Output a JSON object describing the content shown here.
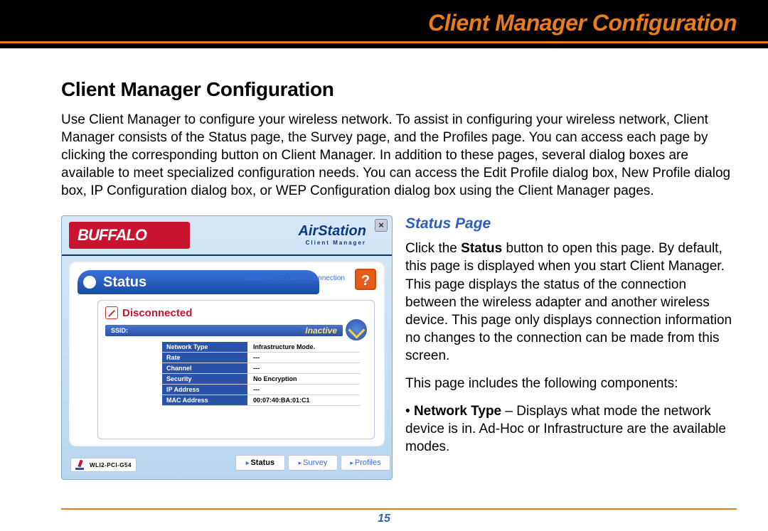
{
  "header": {
    "title": "Client Manager Configuration"
  },
  "doc": {
    "heading": "Client Manager Configuration",
    "intro": "Use Client Manager to configure your wireless network. To assist in configuring your wireless network, Client Manager consists of the Status page, the Survey page, and the Profiles page. You can access each page by clicking the corresponding button on Client Manager. In addition to these pages, several dialog boxes are available to meet specialized configuration needs. You can access the Edit Profile dialog box, New Profile dialog box, IP Configuration dialog box, or WEP Configuration dialog box using the Client Manager pages.",
    "sub_heading": "Status Page",
    "para1_a": "Click the ",
    "para1_b": "Status",
    "para1_c": " button to open this page. By default, this page is displayed when you start Client Manager. This page displays the status of the connection between the wireless adapter and another wireless device. This page only displays connection information no changes to the connection can be made from this screen.",
    "para2": "This page includes the following components:",
    "bullet1_a": "• ",
    "bullet1_b": "Network Type",
    "bullet1_c": " – Displays what mode the network device is in.  Ad-Hoc or Infrastructure are the available modes.",
    "page_number": "15"
  },
  "screenshot": {
    "brand": "BUFFALO",
    "airstation": "AirStation",
    "airstation_sub": "Client Manager",
    "close": "×",
    "status_label": "Status",
    "status_sub": "Status of the current connection",
    "help": "?",
    "disconnected": "Disconnected",
    "ssid_label": "SSID:",
    "inactive": "Inactive",
    "table": [
      {
        "k": "Network Type",
        "v": "Infrastructure Mode."
      },
      {
        "k": "Rate",
        "v": "---"
      },
      {
        "k": "Channel",
        "v": "---"
      },
      {
        "k": "Security",
        "v": "No Encryption"
      },
      {
        "k": "IP Address",
        "v": "---"
      },
      {
        "k": "MAC Address",
        "v": "00:07:40:BA:01:C1"
      }
    ],
    "tabs": {
      "status": "Status",
      "survey": "Survey",
      "profiles": "Profiles"
    },
    "model": "WLI2-PCI-G54"
  }
}
